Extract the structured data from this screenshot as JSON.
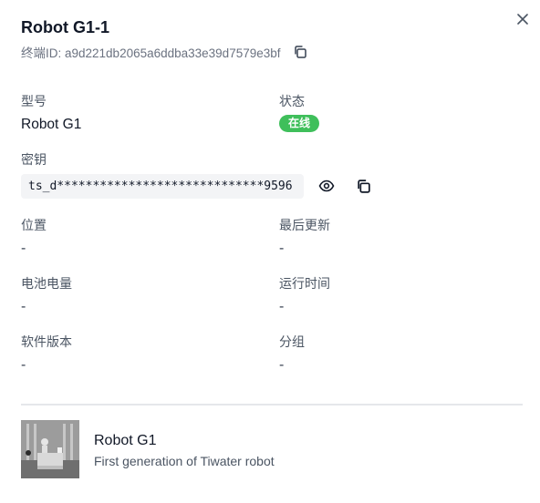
{
  "header": {
    "title": "Robot G1-1",
    "terminal_label": "终端ID: a9d221db2065a6ddba33e39d7579e3bf"
  },
  "fields": {
    "model": {
      "label": "型号",
      "value": "Robot G1"
    },
    "status": {
      "label": "状态",
      "value": "在线",
      "color": "#3fbf5b"
    },
    "secret": {
      "label": "密钥",
      "value": "ts_d*****************************9596"
    },
    "location": {
      "label": "位置",
      "value": "-"
    },
    "last_update": {
      "label": "最后更新",
      "value": "-"
    },
    "battery": {
      "label": "电池电量",
      "value": "-"
    },
    "uptime": {
      "label": "运行时间",
      "value": "-"
    },
    "software_version": {
      "label": "软件版本",
      "value": "-"
    },
    "group": {
      "label": "分组",
      "value": "-"
    }
  },
  "product": {
    "name": "Robot G1",
    "description": "First generation of Tiwater robot"
  },
  "icons": {
    "close": "close-icon",
    "copy": "copy-icon",
    "view": "eye-icon"
  }
}
